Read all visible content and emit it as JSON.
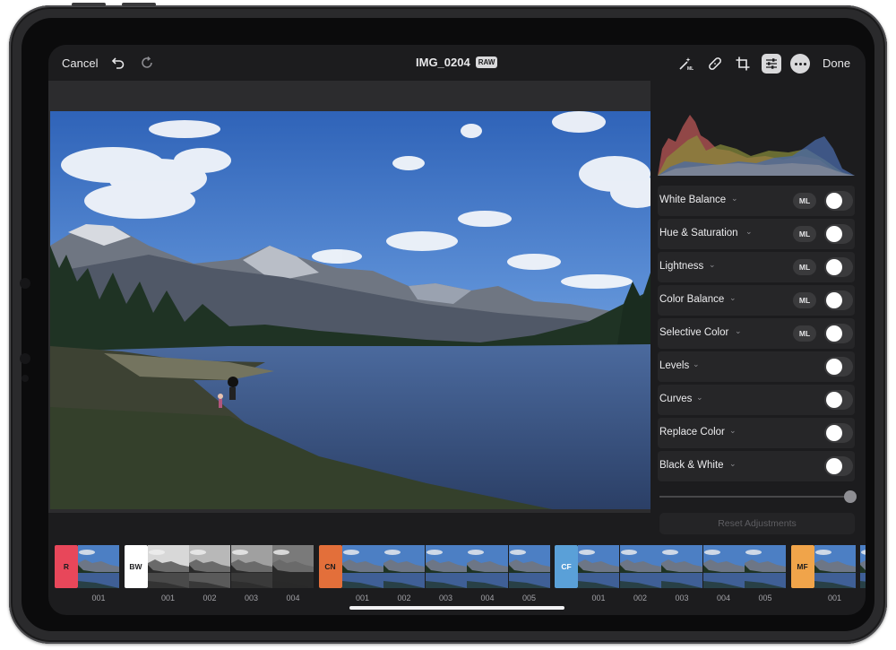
{
  "topbar": {
    "cancel_label": "Cancel",
    "title": "IMG_0204",
    "badge": "RAW",
    "done_label": "Done",
    "tools": [
      "magic-wand-ml-icon",
      "bandage-icon",
      "crop-icon",
      "adjust-sliders-icon",
      "more-icon"
    ]
  },
  "adjustments": [
    {
      "label": "White Balance",
      "ml": true
    },
    {
      "label": "Hue & Saturation",
      "ml": true
    },
    {
      "label": "Lightness",
      "ml": true
    },
    {
      "label": "Color Balance",
      "ml": true
    },
    {
      "label": "Selective Color",
      "ml": true
    },
    {
      "label": "Levels",
      "ml": false
    },
    {
      "label": "Curves",
      "ml": false
    },
    {
      "label": "Replace Color",
      "ml": false
    },
    {
      "label": "Black & White",
      "ml": false
    }
  ],
  "ml_label": "ML",
  "reset_label": "Reset Adjustments",
  "filter_groups": [
    {
      "tag": "R",
      "color": "#e8475a",
      "text_color": "#1c1c1e",
      "style": "color",
      "items": [
        "001"
      ]
    },
    {
      "tag": "BW",
      "color": "#ffffff",
      "text_color": "#1c1c1e",
      "style": "bw",
      "items": [
        "001",
        "002",
        "003",
        "004"
      ]
    },
    {
      "tag": "CN",
      "color": "#e36f3a",
      "text_color": "#1c1c1e",
      "style": "color",
      "items": [
        "001",
        "002",
        "003",
        "004",
        "005"
      ]
    },
    {
      "tag": "CF",
      "color": "#5aa0d8",
      "text_color": "#ffffff",
      "style": "color",
      "items": [
        "001",
        "002",
        "003",
        "004",
        "005"
      ]
    },
    {
      "tag": "MF",
      "color": "#f0a44a",
      "text_color": "#1c1c1e",
      "style": "color",
      "items": [
        "001"
      ]
    }
  ]
}
